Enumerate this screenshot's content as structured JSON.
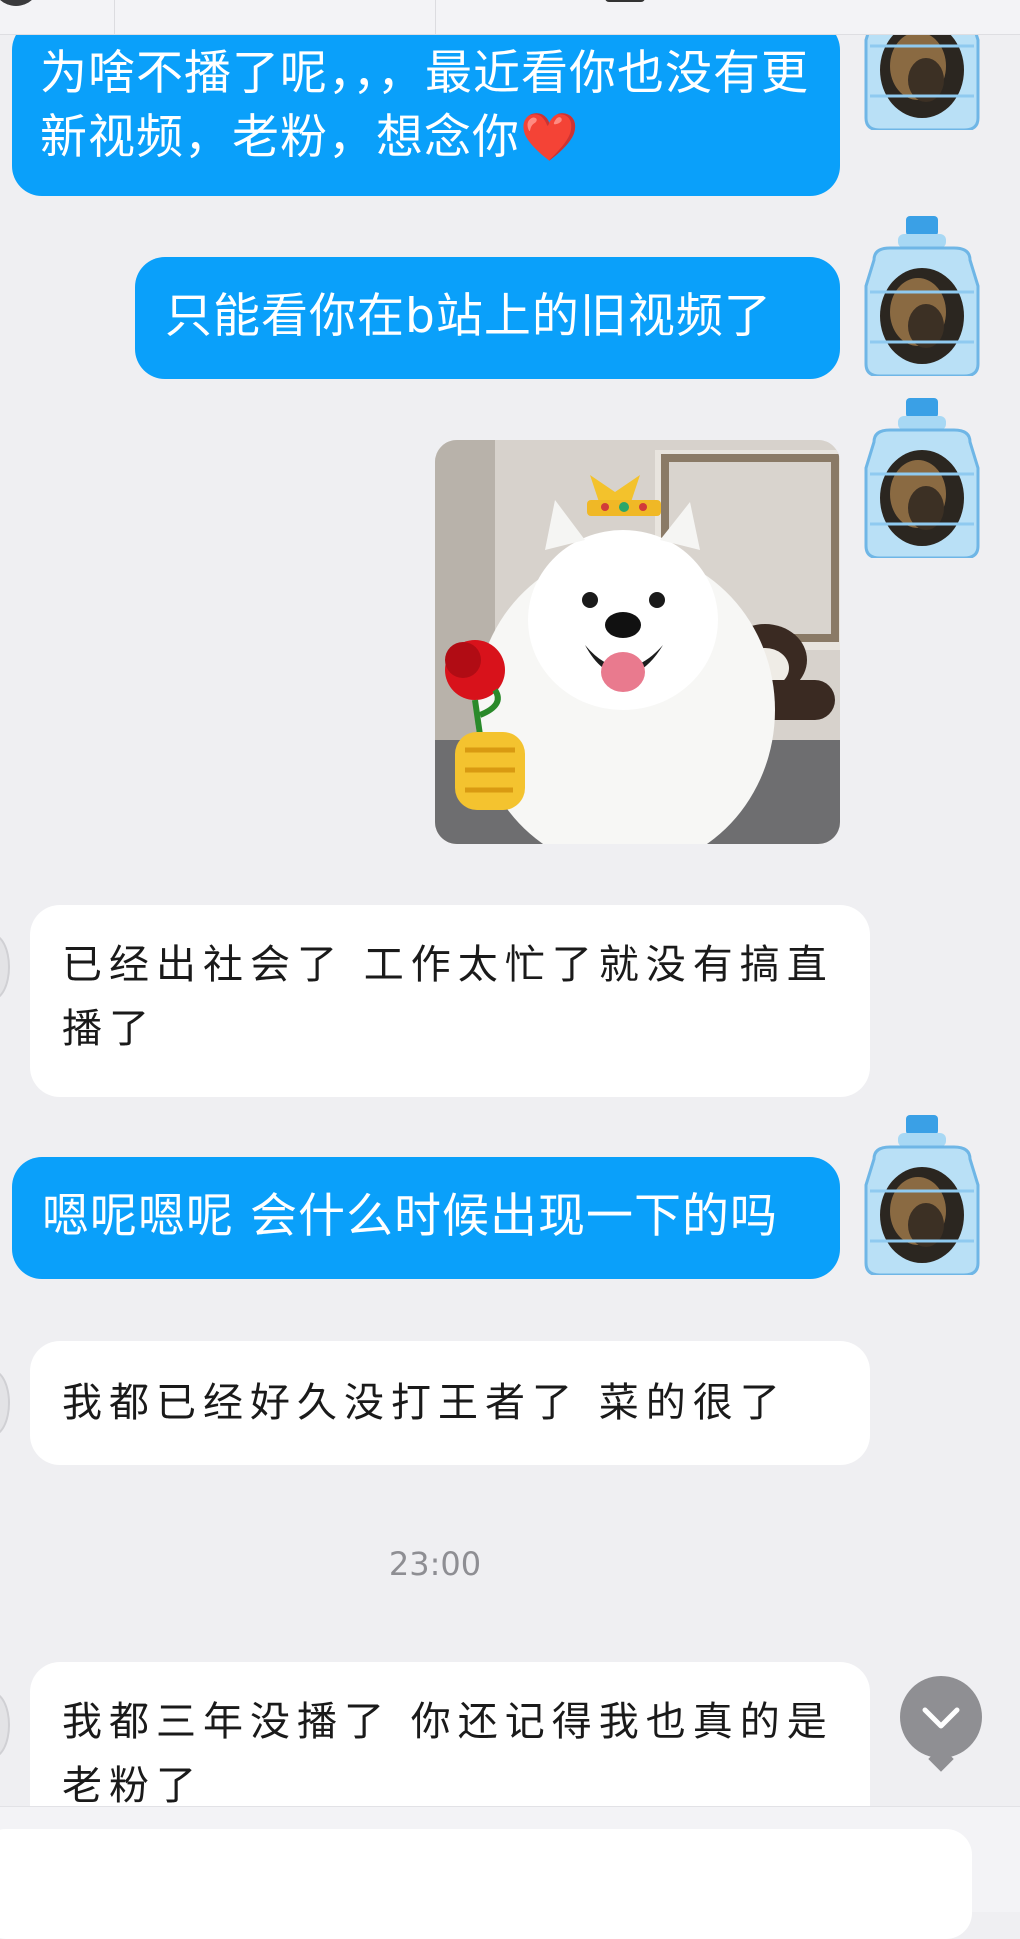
{
  "messages": [
    {
      "side": "right",
      "type": "text",
      "text": "为啥不播了呢，，，最近看你也没有更新视频，老粉，想念你❤️"
    },
    {
      "side": "right",
      "type": "text",
      "text": "只能看你在b站上的旧视频了"
    },
    {
      "side": "right",
      "type": "image",
      "image": "samoyed-with-crown-and-rose"
    },
    {
      "side": "left",
      "type": "text",
      "text": "已经出社会了 工作太忙了就没有搞直播了"
    },
    {
      "side": "right",
      "type": "text",
      "text": "嗯呢嗯呢 会什么时候出现一下的吗"
    },
    {
      "side": "left",
      "type": "text",
      "text": "我都已经好久没打王者了 菜的很了"
    },
    {
      "side": "left",
      "type": "text",
      "text": "我都三年没播了 你还记得我也真的是老粉了"
    }
  ],
  "timestamp": "23:00",
  "icons": {
    "self_avatar": "water-jug-avatar-icon",
    "scroll_down": "chevron-down-icon"
  },
  "colors": {
    "sent_bubble": "#0aa0fa",
    "received_bubble": "#ffffff",
    "background": "#efeff2"
  }
}
